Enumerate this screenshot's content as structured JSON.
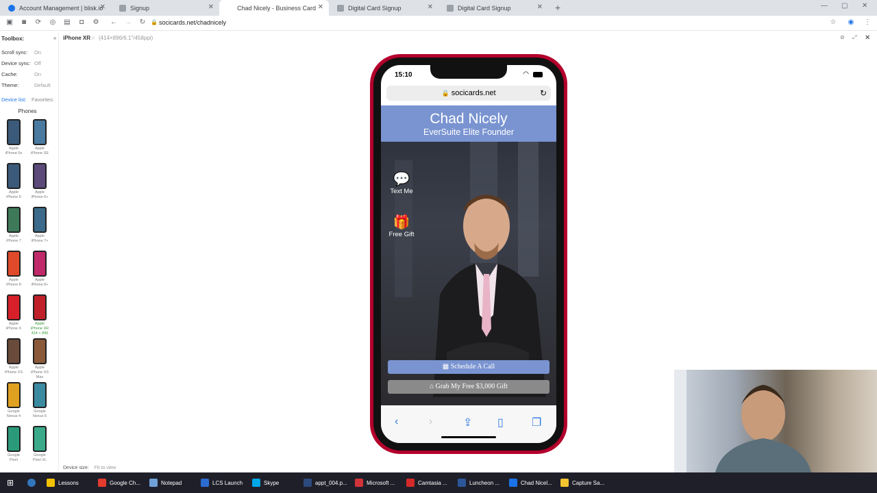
{
  "browser": {
    "tabs": [
      {
        "title": "Account Management | blisk.io",
        "color": "#1a73e8"
      },
      {
        "title": "Signup",
        "color": "#5f6368"
      },
      {
        "title": "Chad Nicely - Business Card",
        "color": "#5f6368"
      },
      {
        "title": "Digital Card Signup",
        "color": "#5f6368"
      },
      {
        "title": "Digital Card Signup",
        "color": "#5f6368"
      }
    ],
    "new_tab": "+",
    "url": "socicards.net/chadnicely"
  },
  "device_header": {
    "device_name": "iPhone XR",
    "device_meta": "(414×896/6.1\"/458ppi)"
  },
  "toolbox": {
    "title": "Toolbox:",
    "settings": [
      {
        "label": "Scroll sync:",
        "value": "On"
      },
      {
        "label": "Device sync:",
        "value": "Off"
      },
      {
        "label": "Cache:",
        "value": "On"
      },
      {
        "label": "Theme:",
        "value": "Default"
      }
    ],
    "device_list_label": "Device list:",
    "favorites_label": "Favorites:",
    "phones_label": "Phones",
    "devices": [
      {
        "brand": "Apple",
        "model": "iPhone 5s"
      },
      {
        "brand": "Apple",
        "model": "iPhone SE"
      },
      {
        "brand": "Apple",
        "model": "iPhone 6"
      },
      {
        "brand": "Apple",
        "model": "iPhone 6+"
      },
      {
        "brand": "Apple",
        "model": "iPhone 7"
      },
      {
        "brand": "Apple",
        "model": "iPhone 7+"
      },
      {
        "brand": "Apple",
        "model": "iPhone 8"
      },
      {
        "brand": "Apple",
        "model": "iPhone 8+"
      },
      {
        "brand": "Apple",
        "model": "iPhone X"
      },
      {
        "brand": "Apple",
        "model": "iPhone XR",
        "extra": "414 × 896"
      },
      {
        "brand": "Apple",
        "model": "iPhone XS"
      },
      {
        "brand": "Apple",
        "model": "iPhone XS Max"
      },
      {
        "brand": "Google",
        "model": "Nexus 4"
      },
      {
        "brand": "Google",
        "model": "Nexus 6"
      },
      {
        "brand": "Google",
        "model": "Pixel"
      },
      {
        "brand": "Google",
        "model": "Pixel XL"
      }
    ],
    "device_size_label": "Device size:",
    "device_size_value": "Fit to view"
  },
  "phone": {
    "time": "15:10",
    "address": "socicards.net",
    "name": "Chad Nicely",
    "tagline": "EverSuite Elite Founder",
    "text_me": "Text Me",
    "free_gift": "Free Gift",
    "schedule_label": "Schedule A Call",
    "gift_label": "Grab My Free $3,000 Gift",
    "colors": {
      "banner": "#7a94d1",
      "frame": "#b3002c",
      "gift_btn": "#8a8a8a"
    }
  },
  "taskbar": {
    "items": [
      {
        "label": "Lessons",
        "color": "#f2c200"
      },
      {
        "label": "Google Ch...",
        "color": "#e33b2e"
      },
      {
        "label": "Notepad",
        "color": "#6fa1d8"
      },
      {
        "label": "LCS Launch",
        "color": "#2b6cd1"
      },
      {
        "label": "Skype",
        "color": "#00a8e8"
      },
      {
        "label": "appt_004.p...",
        "color": "#2c4a7d"
      },
      {
        "label": "Microsoft ...",
        "color": "#d13438"
      },
      {
        "label": "Camtasia ...",
        "color": "#d42a2a"
      },
      {
        "label": "Luncheon ...",
        "color": "#2b579a"
      },
      {
        "label": "Chad Nicel...",
        "color": "#1a73e8"
      },
      {
        "label": "Capture Sa...",
        "color": "#f4c430"
      }
    ]
  }
}
